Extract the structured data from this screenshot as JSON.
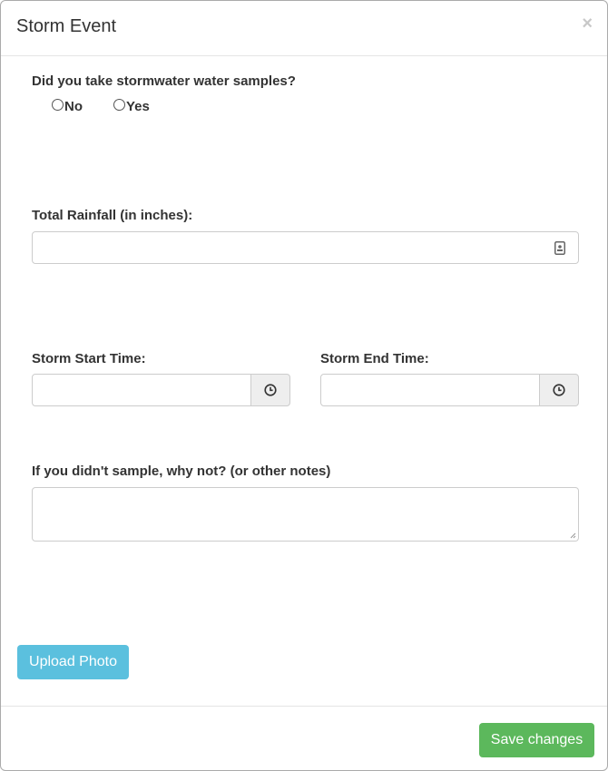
{
  "header": {
    "title": "Storm Event",
    "close_icon": "×"
  },
  "samples": {
    "question": "Did you take stormwater water samples?",
    "options": [
      "No",
      "Yes"
    ]
  },
  "rainfall": {
    "label": "Total Rainfall (in inches):",
    "value": ""
  },
  "start_time": {
    "label": "Storm Start Time:",
    "value": ""
  },
  "end_time": {
    "label": "Storm End Time:",
    "value": ""
  },
  "notes": {
    "label": "If you didn't sample, why not? (or other notes)",
    "value": ""
  },
  "buttons": {
    "upload": "Upload Photo",
    "save": "Save changes"
  },
  "colors": {
    "upload": "#5bc0de",
    "save": "#5cb85c"
  }
}
